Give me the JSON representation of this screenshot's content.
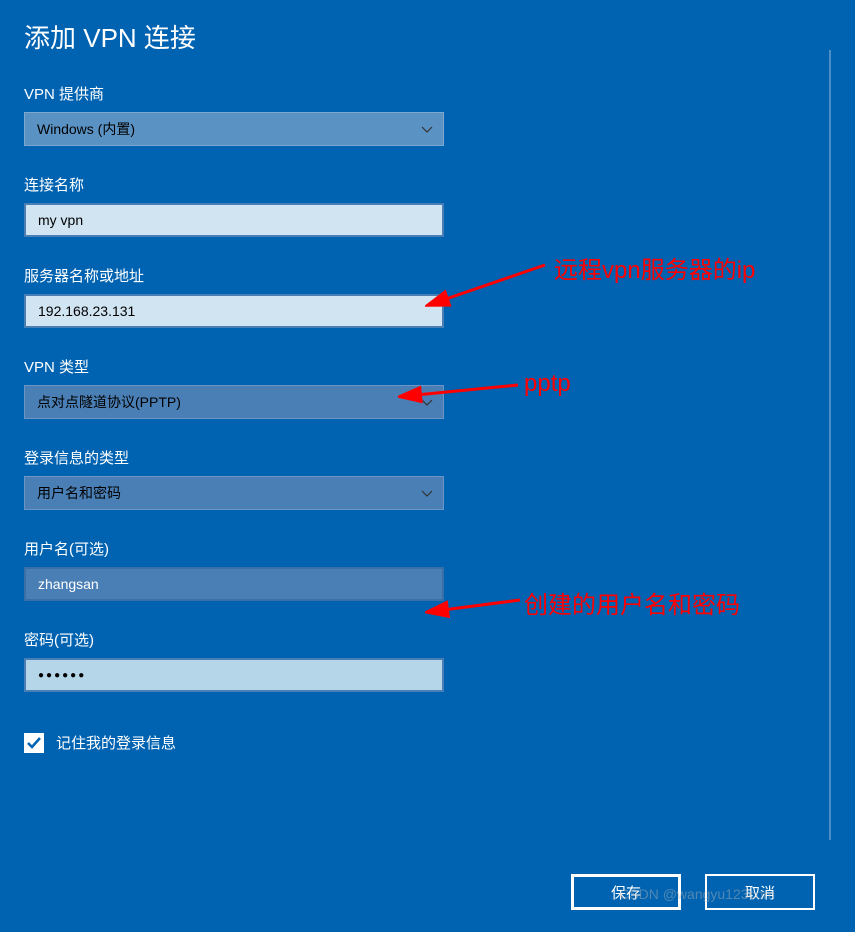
{
  "title": "添加 VPN 连接",
  "form": {
    "provider": {
      "label": "VPN 提供商",
      "value": "Windows (内置)"
    },
    "connectionName": {
      "label": "连接名称",
      "value": "my vpn"
    },
    "serverAddress": {
      "label": "服务器名称或地址",
      "value": "192.168.23.131"
    },
    "vpnType": {
      "label": "VPN 类型",
      "value": "点对点隧道协议(PPTP)"
    },
    "signInType": {
      "label": "登录信息的类型",
      "value": "用户名和密码"
    },
    "username": {
      "label": "用户名(可选)",
      "value": "zhangsan"
    },
    "password": {
      "label": "密码(可选)",
      "value": "●●●●●●"
    },
    "remember": {
      "label": "记住我的登录信息",
      "checked": true
    }
  },
  "buttons": {
    "save": "保存",
    "cancel": "取消"
  },
  "annotations": {
    "serverIp": "远程vpn服务器的ip",
    "vpnType": "pptp",
    "credentials": "创建的用户名和密码"
  },
  "watermark": "CSDN @wangyu123com"
}
